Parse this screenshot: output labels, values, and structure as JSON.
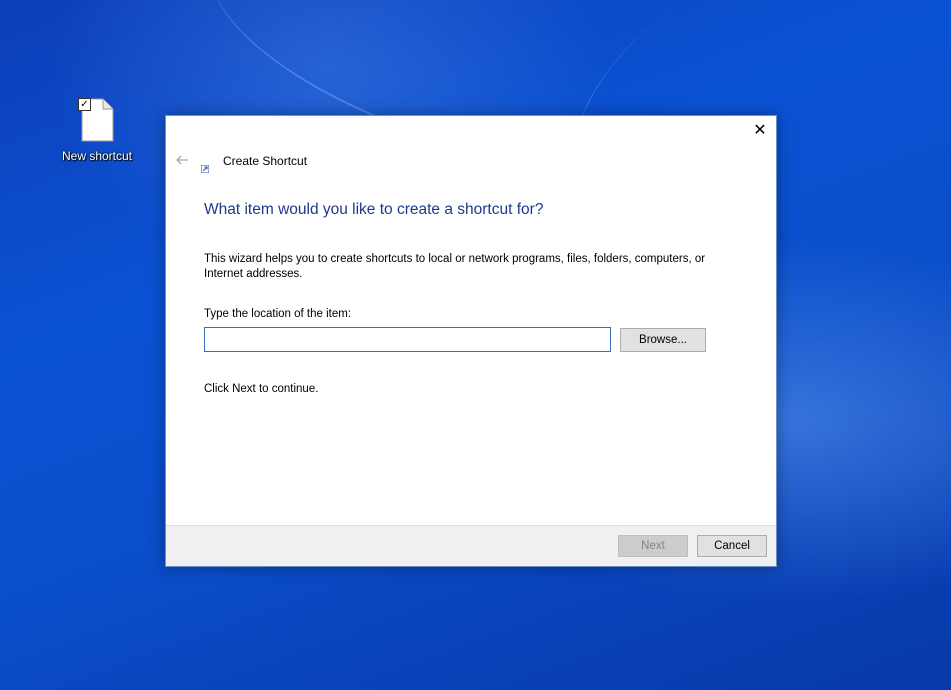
{
  "desktop": {
    "icon": {
      "label": "New shortcut",
      "icon_name": "blank-file-icon",
      "checkbox_glyph": "✓"
    }
  },
  "dialog": {
    "title": "Create Shortcut",
    "close_glyph": "✕",
    "heading": "What item would you like to create a shortcut for?",
    "description": "This wizard helps you to create shortcuts to local or network programs, files, folders, computers, or Internet addresses.",
    "location_label": "Type the location of the item:",
    "location_value": "",
    "browse_label": "Browse...",
    "continue_text": "Click Next to continue.",
    "next_label": "Next",
    "cancel_label": "Cancel"
  },
  "colors": {
    "heading": "#1d3a8a",
    "input_border": "#3a6db8",
    "desktop_blue": "#0a52d4"
  }
}
